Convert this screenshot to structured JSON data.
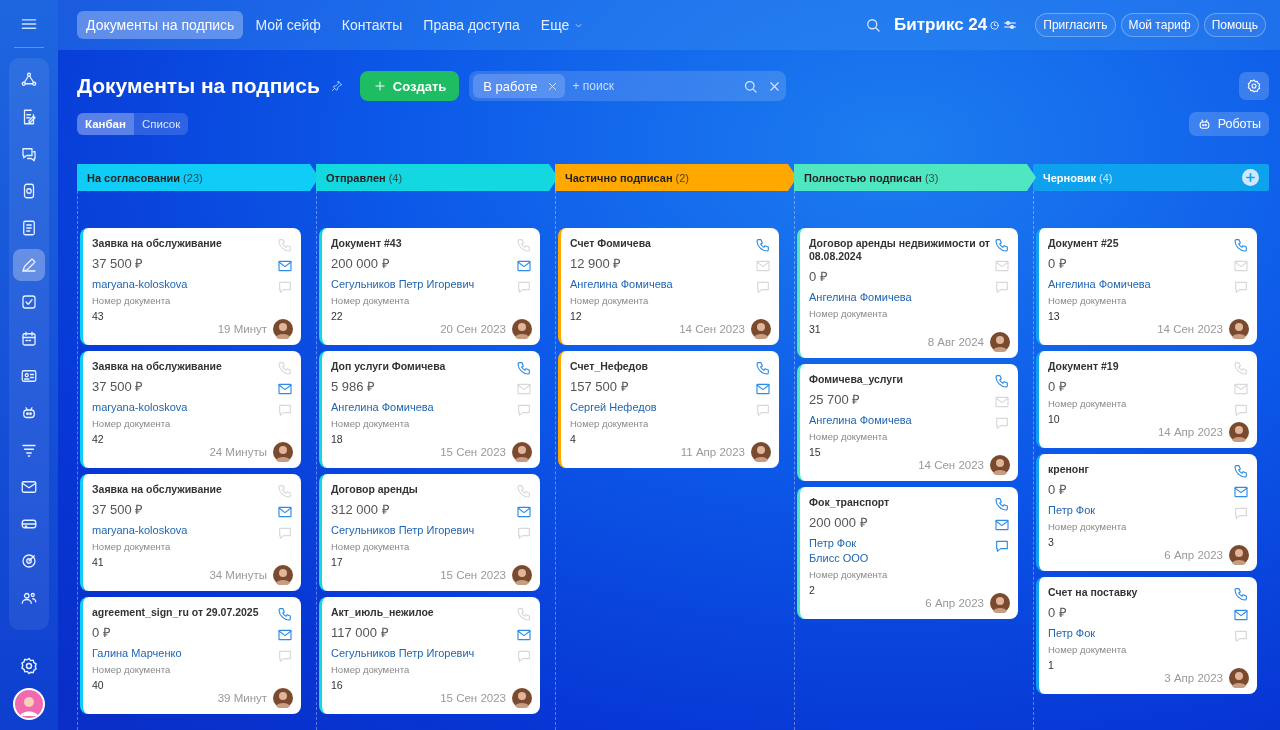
{
  "sidebar": {
    "items": [
      {
        "selected": false
      },
      {
        "selected": false
      },
      {
        "selected": false
      },
      {
        "selected": false
      },
      {
        "selected": false
      },
      {
        "selected": true
      },
      {
        "selected": false
      },
      {
        "selected": false
      },
      {
        "selected": false
      },
      {
        "selected": false
      },
      {
        "selected": false
      },
      {
        "selected": false
      },
      {
        "selected": false
      },
      {
        "selected": false
      },
      {
        "selected": false
      }
    ]
  },
  "topnav": {
    "tabs": [
      {
        "label": "Документы на подпись",
        "selected": true
      },
      {
        "label": "Мой сейф",
        "selected": false
      },
      {
        "label": "Контакты",
        "selected": false
      },
      {
        "label": "Права доступа",
        "selected": false
      },
      {
        "label": "Еще",
        "selected": false
      }
    ],
    "logo": "Битрикс 24",
    "buttons": [
      "Пригласить",
      "Мой тариф",
      "Помощь"
    ]
  },
  "header": {
    "title": "Документы на подпись",
    "create_button": "Создать",
    "filter": {
      "chip": "В работе",
      "placeholder": "+ поиск"
    }
  },
  "views": [
    {
      "label": "Канбан",
      "selected": true
    },
    {
      "label": "Список",
      "selected": false
    }
  ],
  "robots_button": "Роботы",
  "columns": [
    {
      "title": "На согласовании",
      "count": "(23)",
      "color": "#10cdf8",
      "cards": [
        {
          "title": "Заявка на обслуживание",
          "amount": "37 500 ₽",
          "contacts": [
            "maryana-koloskova"
          ],
          "field_label": "Номер документа",
          "number": "43",
          "date": "19 Минут",
          "phone": false,
          "mail": true,
          "chat": false
        },
        {
          "title": "Заявка на обслуживание",
          "amount": "37 500 ₽",
          "contacts": [
            "maryana-koloskova"
          ],
          "field_label": "Номер документа",
          "number": "42",
          "date": "24 Минуты",
          "phone": false,
          "mail": true,
          "chat": false
        },
        {
          "title": "Заявка на обслуживание",
          "amount": "37 500 ₽",
          "contacts": [
            "maryana-koloskova"
          ],
          "field_label": "Номер документа",
          "number": "41",
          "date": "34 Минуты",
          "phone": false,
          "mail": true,
          "chat": false
        },
        {
          "title": "agreement_sign_ru от 29.07.2025",
          "amount": "0 ₽",
          "contacts": [
            "Галина Марченко"
          ],
          "field_label": "Номер документа",
          "number": "40",
          "date": "39 Минут",
          "phone": true,
          "mail": true,
          "chat": false
        }
      ]
    },
    {
      "title": "Отправлен",
      "count": "(4)",
      "color": "#13d8e0",
      "cards": [
        {
          "title": "Документ #43",
          "amount": "200 000 ₽",
          "contacts": [
            "Сегульников Петр Игоревич"
          ],
          "field_label": "Номер документа",
          "number": "22",
          "date": "20 Сен 2023",
          "phone": false,
          "mail": true,
          "chat": false
        },
        {
          "title": "Доп услуги Фомичева",
          "amount": "5 986 ₽",
          "contacts": [
            "Ангелина Фомичева"
          ],
          "field_label": "Номер документа",
          "number": "18",
          "date": "15 Сен 2023",
          "phone": true,
          "mail": false,
          "chat": false
        },
        {
          "title": "Договор аренды",
          "amount": "312 000 ₽",
          "contacts": [
            "Сегульников Петр Игоревич"
          ],
          "field_label": "Номер документа",
          "number": "17",
          "date": "15 Сен 2023",
          "phone": false,
          "mail": true,
          "chat": false
        },
        {
          "title": "Акт_июль_нежилое",
          "amount": "117 000 ₽",
          "contacts": [
            "Сегульников Петр Игоревич"
          ],
          "field_label": "Номер документа",
          "number": "16",
          "date": "15 Сен 2023",
          "phone": false,
          "mail": true,
          "chat": false
        }
      ]
    },
    {
      "title": "Частично подписан",
      "count": "(2)",
      "color": "#ffa800",
      "cards": [
        {
          "title": "Счет Фомичева",
          "amount": "12 900 ₽",
          "contacts": [
            "Ангелина Фомичева"
          ],
          "field_label": "Номер документа",
          "number": "12",
          "date": "14 Сен 2023",
          "phone": true,
          "mail": false,
          "chat": false
        },
        {
          "title": "Счет_Нефедов",
          "amount": "157 500 ₽",
          "contacts": [
            "Сергей Нефедов"
          ],
          "field_label": "Номер документа",
          "number": "4",
          "date": "11 Апр 2023",
          "phone": true,
          "mail": true,
          "chat": false
        }
      ]
    },
    {
      "title": "Полностью подписан",
      "count": "(3)",
      "color": "#4fe6c2",
      "cards": [
        {
          "title": "Договор аренды недвижимости от 08.08.2024",
          "amount": "0 ₽",
          "contacts": [
            "Ангелина Фомичева"
          ],
          "field_label": "Номер документа",
          "number": "31",
          "date": "8 Авг 2024",
          "phone": true,
          "mail": false,
          "chat": false
        },
        {
          "title": "Фомичева_услуги",
          "amount": "25 700 ₽",
          "contacts": [
            "Ангелина Фомичева"
          ],
          "field_label": "Номер документа",
          "number": "15",
          "date": "14 Сен 2023",
          "phone": true,
          "mail": false,
          "chat": false
        },
        {
          "title": "Фок_транспорт",
          "amount": "200 000 ₽",
          "contacts": [
            "Петр Фок",
            "Блисс ООО"
          ],
          "field_label": "Номер документа",
          "number": "2",
          "date": "6 Апр 2023",
          "phone": true,
          "mail": true,
          "chat": true
        }
      ]
    },
    {
      "title": "Черновик",
      "count": "(4)",
      "color": "#0ea2ee",
      "cards": [
        {
          "title": "Документ #25",
          "amount": "0 ₽",
          "contacts": [
            "Ангелина Фомичева"
          ],
          "field_label": "Номер документа",
          "number": "13",
          "date": "14 Сен 2023",
          "phone": true,
          "mail": false,
          "chat": false
        },
        {
          "title": "Документ #19",
          "amount": "0 ₽",
          "field_label": "Номер документа",
          "number": "10",
          "date": "14 Апр 2023",
          "phone": false,
          "mail": false,
          "chat": false
        },
        {
          "title": "кренонг",
          "amount": "0 ₽",
          "contacts": [
            "Петр Фок"
          ],
          "field_label": "Номер документа",
          "number": "3",
          "date": "6 Апр 2023",
          "phone": true,
          "mail": true,
          "chat": false
        },
        {
          "title": "Счет на поставку",
          "amount": "0 ₽",
          "contacts": [
            "Петр Фок"
          ],
          "field_label": "Номер документа",
          "number": "1",
          "date": "3 Апр 2023",
          "phone": true,
          "mail": true,
          "chat": false
        }
      ]
    }
  ]
}
